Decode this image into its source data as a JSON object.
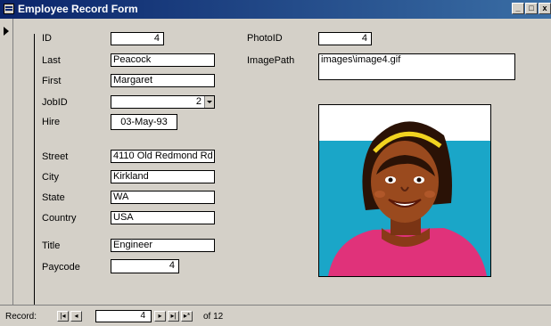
{
  "window": {
    "title": "Employee Record Form",
    "minimize_label": "_",
    "maximize_label": "□",
    "close_label": "x"
  },
  "form": {
    "id": {
      "label": "ID",
      "value": "4"
    },
    "last": {
      "label": "Last",
      "value": "Peacock"
    },
    "first": {
      "label": "First",
      "value": "Margaret"
    },
    "jobid": {
      "label": "JobID",
      "value": "2"
    },
    "hire": {
      "label": "Hire",
      "value": "03-May-93"
    },
    "street": {
      "label": "Street",
      "value": "4110 Old Redmond Rd"
    },
    "city": {
      "label": "City",
      "value": "Kirkland"
    },
    "state": {
      "label": "State",
      "value": "WA"
    },
    "country": {
      "label": "Country",
      "value": "USA"
    },
    "title": {
      "label": "Title",
      "value": "Engineer"
    },
    "paycode": {
      "label": "Paycode",
      "value": "4"
    },
    "photoid": {
      "label": "PhotoID",
      "value": "4"
    },
    "imagepath": {
      "label": "ImagePath",
      "value": "images\\image4.gif"
    }
  },
  "photo": {
    "icon": "employee-portrait-image"
  },
  "navigation": {
    "record_label": "Record:",
    "first_label": "|◂",
    "prev_label": "◂",
    "current": "4",
    "next_label": "▸",
    "last_label": "▸|",
    "new_label": "▸*",
    "of_count": "of 12"
  },
  "colors": {
    "title_bar": "#0a246a",
    "form_background": "#d4d0c8",
    "photo_sky": "#1aa6c8",
    "photo_shirt": "#e0327a",
    "headband": "#f2d420"
  }
}
